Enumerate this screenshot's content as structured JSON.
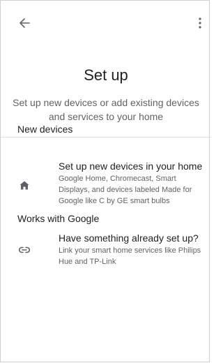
{
  "header": {
    "back_icon": "arrow-back-icon",
    "menu_icon": "more-vert-icon"
  },
  "main": {
    "title": "Set up",
    "subtitle": "Set up new devices or add existing devices and services to your home"
  },
  "sections": [
    {
      "header": "New devices",
      "item": {
        "icon": "home-icon",
        "title": "Set up new devices in your home",
        "description": "Google Home, Chromecast, Smart Displays, and devices labeled Made for Google like C by GE smart bulbs"
      }
    },
    {
      "header": "Works with Google",
      "item": {
        "icon": "link-icon",
        "title": "Have something already set up?",
        "description": "Link your smart home services like Philips Hue and TP-Link"
      }
    }
  ],
  "colors": {
    "text_primary": "#202124",
    "text_secondary": "#5f6368",
    "icon": "#5f6368",
    "divider": "#e0e0e0"
  }
}
